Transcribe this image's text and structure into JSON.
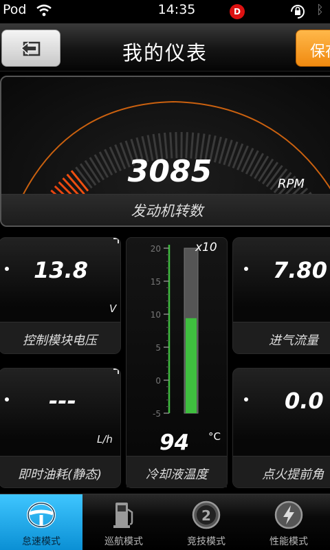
{
  "status_bar": {
    "carrier": "Pod",
    "time": "14:35",
    "badge": "D",
    "icons": [
      "wifi-icon",
      "rotation-lock-icon",
      "bluetooth-icon"
    ]
  },
  "header": {
    "title": "我的仪表",
    "save_label": "保存",
    "back_icon": "return-icon"
  },
  "rpm": {
    "value": "3085",
    "unit": "RPM",
    "label": "发动机转数",
    "fill_fraction": 0.31
  },
  "gauges": {
    "voltage": {
      "value": "13.8",
      "unit": "V",
      "label": "控制模块电压"
    },
    "airflow": {
      "value": "7.80",
      "label": "进气流量"
    },
    "fuel": {
      "value": "---",
      "unit": "L/h",
      "label": "即时油耗(静态)"
    },
    "ignition": {
      "value": "0.0",
      "label": "点火提前角"
    }
  },
  "coolant": {
    "multiplier": "x10",
    "scale_ticks": [
      "20",
      "15",
      "10",
      "5",
      "0",
      "-5"
    ],
    "scale_min": -5,
    "scale_max": 20,
    "level": 9.4,
    "value": "94",
    "unit": "°C",
    "label": "冷却液温度"
  },
  "tabs": [
    {
      "label": "怠速模式",
      "icon": "steering-wheel-icon",
      "active": true
    },
    {
      "label": "巡航模式",
      "icon": "fuel-pump-icon",
      "active": false
    },
    {
      "label": "竞技模式",
      "icon": "speedometer-icon",
      "active": false
    },
    {
      "label": "性能模式",
      "icon": "lightning-icon",
      "active": false
    }
  ],
  "colors": {
    "accent_orange": "#f08a10",
    "active_tab_blue": "#1aa8ec",
    "gauge_green": "#3fbf3f",
    "rpm_red": "#e02010"
  }
}
